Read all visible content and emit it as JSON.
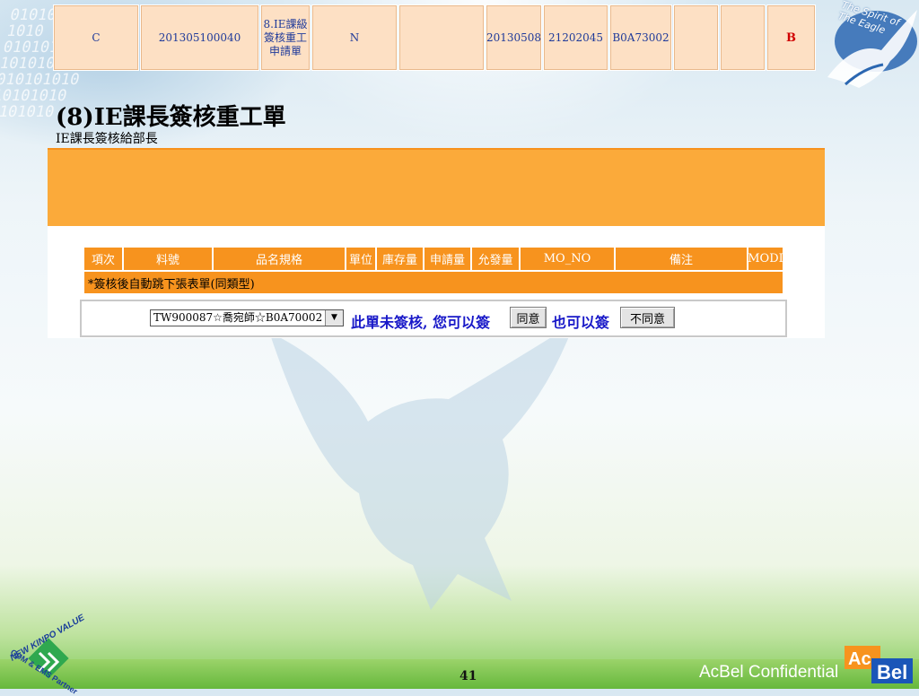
{
  "slide": {
    "title": "(8)IE課長簽核重工單",
    "subtitle": "IE課長簽核給部長",
    "page_number": "41",
    "confidential": "AcBel Confidential",
    "emblem_text": "The Spirit of The Eagle",
    "logo_acbel_a": "Ac",
    "logo_acbel_b": "Bel",
    "logo_kinpo_top": "NEW KINPO VALUE",
    "logo_kinpo_bottom": "ODM & EMS Partner"
  },
  "record": {
    "cells": [
      "C",
      "201305100040",
      "8.IE課級簽核重工申請單",
      "N",
      "",
      "20130508",
      "21202045",
      "B0A73002",
      "",
      "",
      "B"
    ]
  },
  "form": {
    "columns": [
      "項次",
      "料號",
      "品名規格",
      "單位",
      "庫存量",
      "申請量",
      "允發量",
      "MO_NO",
      "備注",
      "MODI"
    ],
    "notice": "*簽核後自動跳下張表單(同類型)",
    "approver_select": "TW900087☆喬宛師☆B0A70002",
    "msg_not_signed": "此單未簽核, 您可以簽",
    "btn_agree": "同意",
    "msg_also": "也可以簽",
    "btn_disagree": "不同意"
  },
  "colors": {
    "orange": "#f7931e",
    "light_orange": "#fde0c4",
    "link_blue": "#1818c8",
    "alert_red": "#d00000"
  },
  "icons": [
    "eagle-emblem-icon",
    "dropdown-arrow-icon",
    "acbel-logo-icon",
    "kinpo-logo-icon"
  ]
}
